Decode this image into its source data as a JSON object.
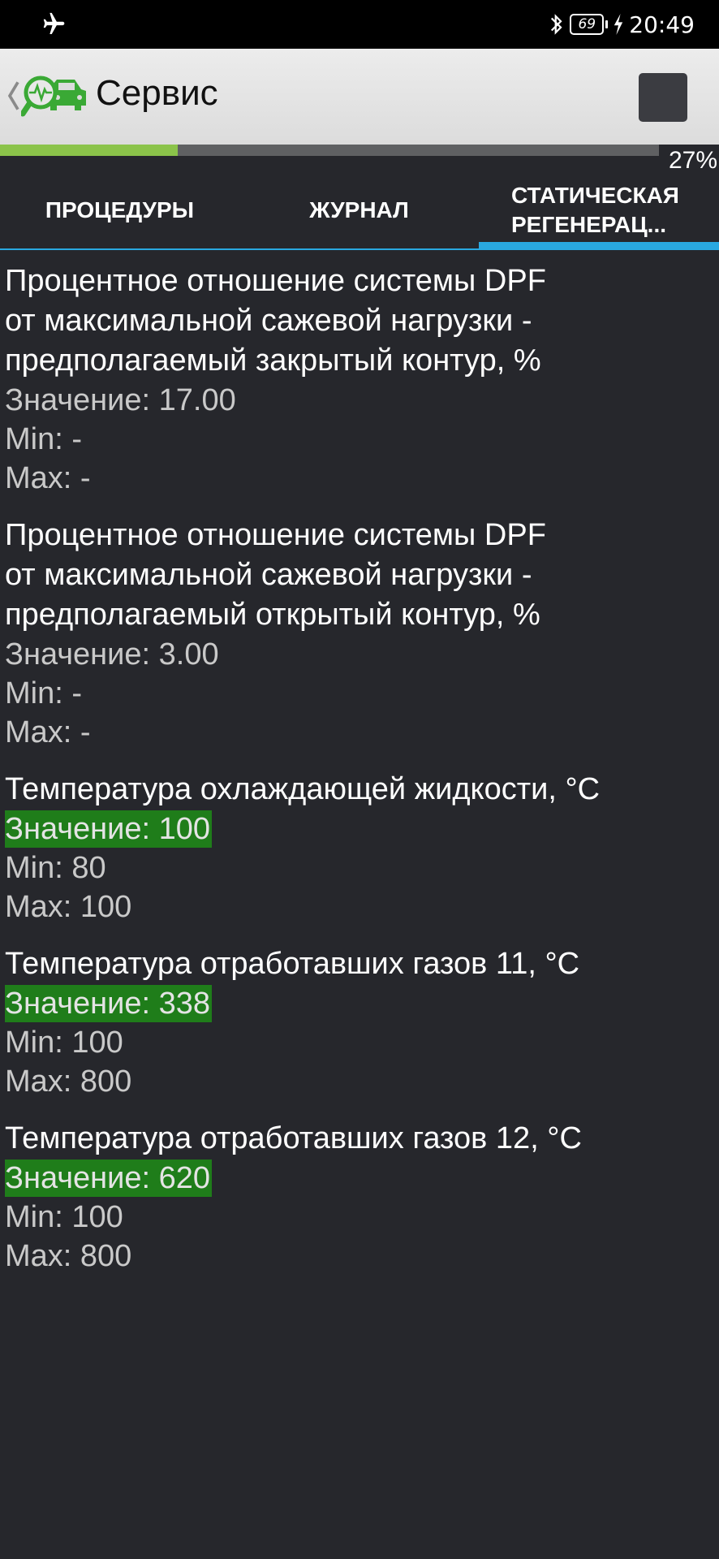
{
  "status_bar": {
    "time": "20:49",
    "battery": "69",
    "icons": [
      "airplane-icon",
      "bluetooth-icon",
      "battery-icon",
      "charging-bolt-icon"
    ]
  },
  "app_bar": {
    "title": "Сервис",
    "icons": [
      "back-chevron-icon",
      "car-diagnostics-logo-icon",
      "stop-icon"
    ]
  },
  "progress": {
    "label": "27%",
    "value_percent": 27
  },
  "tabs": [
    {
      "label": "ПРОЦЕДУРЫ",
      "selected": false
    },
    {
      "label": "ЖУРНАЛ",
      "selected": false
    },
    {
      "label": "СТАТИЧЕСКАЯ РЕГЕНЕРАЦ...",
      "line1": "СТАТИЧЕСКАЯ",
      "line2": "РЕГЕНЕРАЦ...",
      "selected": true
    }
  ],
  "parameters": [
    {
      "title": "Процентное отношение системы DPF от максимальной сажевой нагрузки - предполагаемый закрытый контур, %",
      "title_lines": [
        "Процентное отношение системы DPF",
        "от максимальной сажевой нагрузки -",
        "предполагаемый закрытый контур, %"
      ],
      "value": "Значение: 17.00",
      "min": "Min:  -",
      "max": "Max:  -"
    },
    {
      "title": "Процентное отношение системы DPF от максимальной сажевой нагрузки - предполагаемый открытый контур, %",
      "title_lines": [
        "Процентное отношение системы DPF",
        "от максимальной сажевой нагрузки -",
        "предполагаемый открытый контур, %"
      ],
      "value": "Значение: 3.00",
      "min": "Min:  -",
      "max": "Max:  -"
    },
    {
      "title": "Температура охлаждающей жидкости, °C",
      "value": "Значение: 100",
      "min": "Min: 80",
      "max": "Max: 100"
    },
    {
      "title": "Температура отработавших газов 11, °C",
      "value": "Значение: 338",
      "min": "Min: 100",
      "max": "Max: 800"
    },
    {
      "title": "Температура отработавших газов 12, °C",
      "value": "Значение: 620",
      "min": "Min: 100",
      "max": "Max: 800"
    }
  ],
  "colors": {
    "background": "#26272c",
    "accent": "#29a8e0",
    "progress": "#8bc34a",
    "in_range": "#1f7d1a"
  }
}
